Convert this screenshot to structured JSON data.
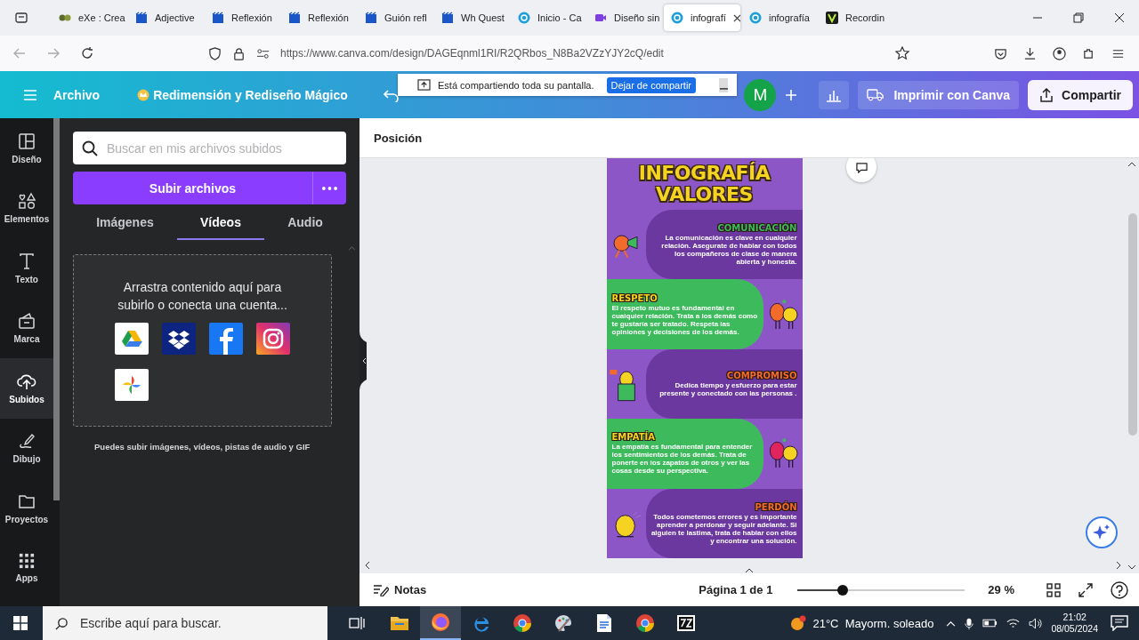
{
  "browser": {
    "tabs": [
      {
        "label": "eXe : Crea",
        "kind": "exe",
        "selected": false
      },
      {
        "label": "Adjective",
        "kind": "clapper",
        "selected": false
      },
      {
        "label": "Reflexión",
        "kind": "clapper",
        "selected": false
      },
      {
        "label": "Reflexión",
        "kind": "clapper",
        "selected": false
      },
      {
        "label": "Guión refl",
        "kind": "clapper",
        "selected": false
      },
      {
        "label": "Wh Quest",
        "kind": "clapper",
        "selected": false
      },
      {
        "label": "Inicio - Ca",
        "kind": "canva",
        "selected": false
      },
      {
        "label": "Diseño sin",
        "kind": "video",
        "selected": false
      },
      {
        "label": "infografí",
        "kind": "canva",
        "selected": true
      },
      {
        "label": "infografía",
        "kind": "canva",
        "selected": false
      },
      {
        "label": "Recordin",
        "kind": "veed",
        "selected": false
      }
    ],
    "url": "https://www.canva.com/design/DAGEqnml1RI/R2QRbos_N8Ba2VZzYJY2cQ/edit"
  },
  "header": {
    "menu": "Archivo",
    "magic": "Redimensión y Rediseño Mágico",
    "avatar": "M",
    "print": "Imprimir con Canva",
    "share": "Compartir"
  },
  "share_banner": {
    "message": "Está compartiendo toda su pantalla.",
    "stop": "Dejar de compartir"
  },
  "rail": [
    {
      "label": "Diseño",
      "kind": "layout",
      "selected": false
    },
    {
      "label": "Elementos",
      "kind": "shapes",
      "selected": false
    },
    {
      "label": "Texto",
      "kind": "text",
      "selected": false
    },
    {
      "label": "Marca",
      "kind": "brand",
      "selected": false
    },
    {
      "label": "Subidos",
      "kind": "upload",
      "selected": true
    },
    {
      "label": "Dibujo",
      "kind": "draw",
      "selected": false
    },
    {
      "label": "Proyectos",
      "kind": "folder",
      "selected": false
    },
    {
      "label": "Apps",
      "kind": "apps",
      "selected": false
    }
  ],
  "panel": {
    "search_placeholder": "Buscar en mis archivos subidos",
    "upload": "Subir archivos",
    "tabs": [
      {
        "label": "Imágenes",
        "selected": false
      },
      {
        "label": "Vídeos",
        "selected": true
      },
      {
        "label": "Audio",
        "selected": false
      }
    ],
    "dropzone": "Arrastra contenido aquí para subirlo o conecta una cuenta...",
    "services": [
      {
        "kind": "drive"
      },
      {
        "kind": "dropbox"
      },
      {
        "kind": "facebook"
      },
      {
        "kind": "instagram"
      },
      {
        "kind": "photos"
      }
    ],
    "hint": "Puedes subir imágenes, vídeos, pistas de audio y GIF"
  },
  "toolbar": {
    "label": "Posición"
  },
  "infographic": {
    "title_lines": [
      "INFOGRAFÍA",
      "VALORES"
    ],
    "sections": [
      {
        "heading": "COMUNICACIÓN",
        "color": "#3dbb5c",
        "kind": "megaphone",
        "body": "La comunicación es clave en cualquier relación. Asegurate de hablar con todos los compañeros de clase  de manera abierta y honesta."
      },
      {
        "heading": "RESPETO",
        "color": "#f5d320",
        "kind": "pair",
        "body": "El respeto mutuo es fundamental en cualquier relación. Trata a los demás como te gustaría ser tratado. Respeta las opiniones y decisiones de los demás."
      },
      {
        "heading": "COMPROMISO",
        "color": "#f26b2a",
        "kind": "podium",
        "body": "Dedica tiempo y esfuerzo para estar presente y conectado con las personas ."
      },
      {
        "heading": "EMPATÍA",
        "color": "#f5d320",
        "kind": "pair",
        "body": "La empatía es fundamental para entender los sentimientos de los demás. Trata de ponerte en los zapatos de otros y ver las cosas desde su perspectiva."
      },
      {
        "heading": "PERDÓN",
        "color": "#f26b2a",
        "kind": "sitting",
        "body": "Todos cometemos errores y es importante aprender a perdonar y seguir adelante. Si alguien te lastima, trata de hablar con ellos y encontrar una solución."
      }
    ]
  },
  "footer": {
    "notes": "Notas",
    "page": "Página 1 de 1",
    "zoom": {
      "level": 0.27
    },
    "zoom_reading": "29 %"
  },
  "taskbar": {
    "search_placeholder": "Escribe aquí para buscar.",
    "apps": [
      {
        "kind": "explorer",
        "selected": false
      },
      {
        "kind": "firefox",
        "selected": true
      },
      {
        "kind": "edge",
        "selected": false
      },
      {
        "kind": "chrome",
        "selected": false
      },
      {
        "kind": "paint",
        "selected": false
      },
      {
        "kind": "docs",
        "selected": false
      },
      {
        "kind": "chrome",
        "selected": false
      },
      {
        "kind": "archive",
        "selected": false
      }
    ],
    "weather": "21°C  Mayorm. soleado",
    "time": "21:02",
    "date": "08/05/2024"
  }
}
